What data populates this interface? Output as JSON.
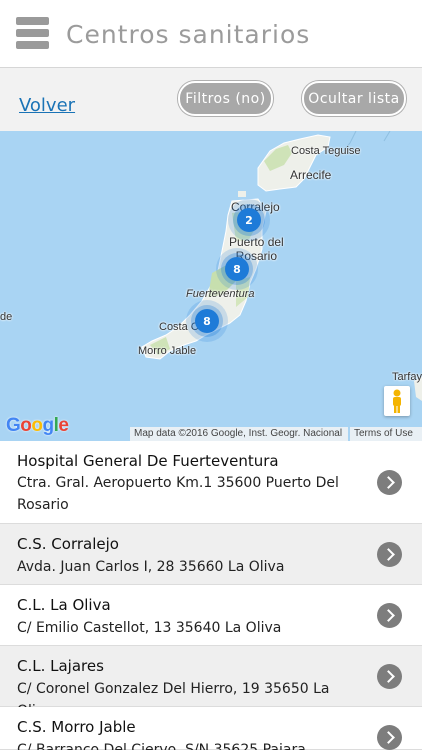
{
  "header": {
    "title": "Centros sanitarios",
    "menu_icon": "hamburger-menu-icon"
  },
  "toolbar": {
    "back_label": "Volver",
    "filters_label": "Filtros (no)",
    "hide_list_label": "Ocultar lista"
  },
  "map": {
    "place_labels": {
      "costa_teguise": "Costa Teguise",
      "arrecife": "Arrecife",
      "corralejo": "Corralejo",
      "puerto_del_rosario": "Puerto del\nRosario",
      "fuerteventura": "Fuerteventura",
      "costa_calma": "Costa C",
      "morro_jable": "Morro Jable",
      "tarfaya": "Tarfay",
      "left_edge": "de"
    },
    "clusters": [
      {
        "name": "corralejo-cluster",
        "count": "2"
      },
      {
        "name": "puerto-del-rosario-cluster",
        "count": "8"
      },
      {
        "name": "costa-calma-cluster",
        "count": "8"
      }
    ],
    "cluster_color": "#1e7bd8",
    "attribution": "Map data ©2016 Google, Inst. Geogr. Nacional",
    "terms": "Terms of Use",
    "logo": "Google"
  },
  "centers": [
    {
      "name": "Hospital General De Fuerteventura",
      "address": "Ctra. Gral. Aeropuerto Km.1 35600 Puerto Del Rosario"
    },
    {
      "name": "C.S. Corralejo",
      "address": "Avda. Juan Carlos I, 28 35660 La Oliva"
    },
    {
      "name": "C.L. La Oliva",
      "address": "C/ Emilio Castellot, 13 35640 La Oliva"
    },
    {
      "name": "C.L. Lajares",
      "address": "C/ Coronel Gonzalez Del Hierro, 19 35650 La Oliva"
    },
    {
      "name": "C.S. Morro Jable",
      "address": "C/ Barranco Del Ciervo, S/N 35625 Pajara"
    }
  ]
}
